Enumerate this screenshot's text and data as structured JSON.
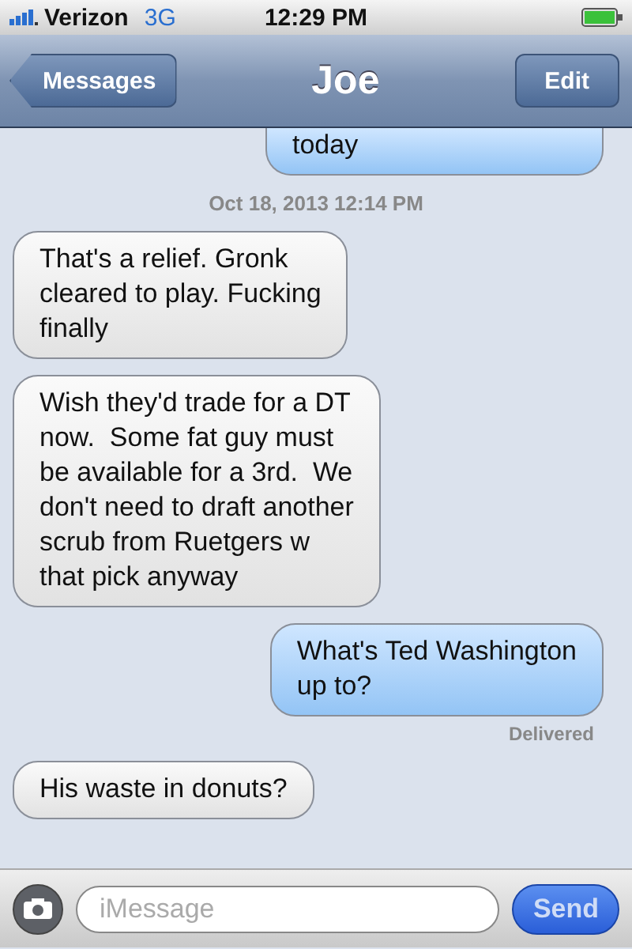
{
  "status_bar": {
    "carrier": "Verizon",
    "network": "3G",
    "time": "12:29 PM"
  },
  "nav": {
    "back": "Messages",
    "title": "Joe",
    "edit": "Edit"
  },
  "messages": [
    {
      "kind": "sent",
      "text": "today",
      "clipped": true
    },
    {
      "kind": "timestamp",
      "text": "Oct 18, 2013 12:14 PM"
    },
    {
      "kind": "received",
      "text": "That's a relief. Gronk\ncleared to play. Fucking\nfinally"
    },
    {
      "kind": "received",
      "text": "Wish they'd trade for a DT\nnow.  Some fat guy must\nbe available for a 3rd.  We\ndon't need to draft another\nscrub from Ruetgers w\nthat pick anyway"
    },
    {
      "kind": "sent",
      "text": "What's Ted Washington\nup to?"
    },
    {
      "kind": "status",
      "text": "Delivered"
    },
    {
      "kind": "received",
      "text": "His waste in donuts?"
    }
  ],
  "composer": {
    "placeholder": "iMessage",
    "send": "Send"
  }
}
